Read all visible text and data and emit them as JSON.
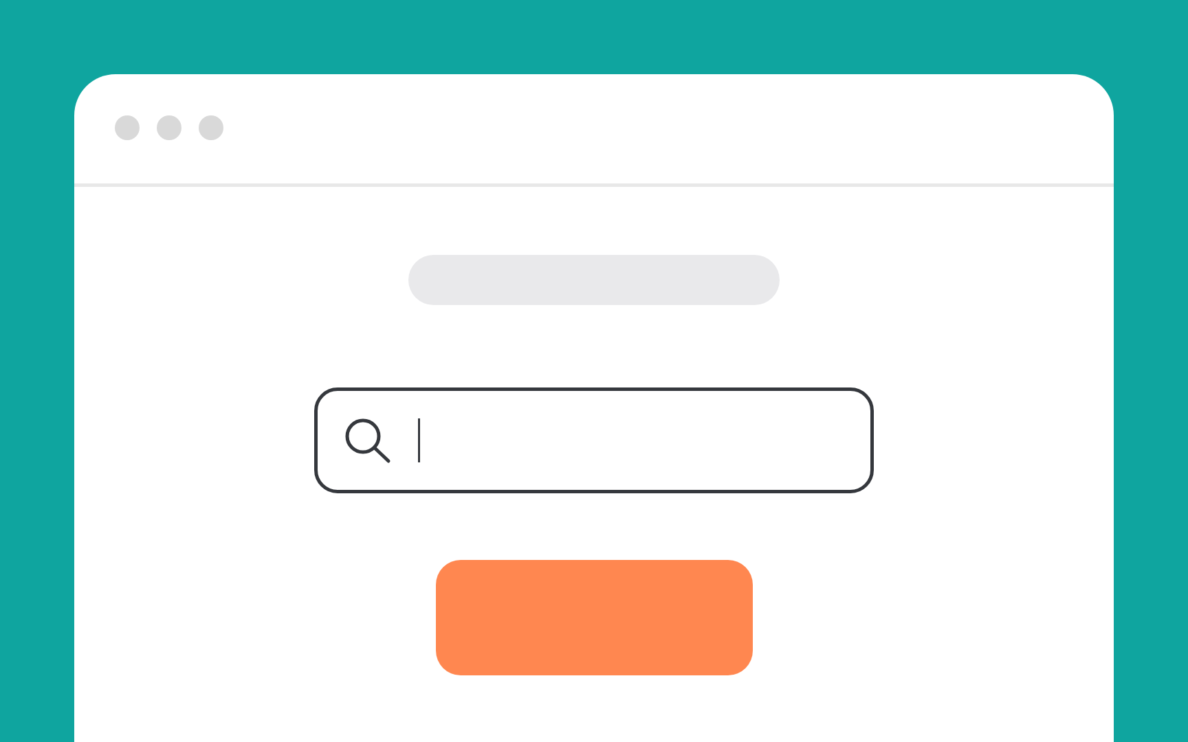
{
  "search": {
    "focused": true
  }
}
